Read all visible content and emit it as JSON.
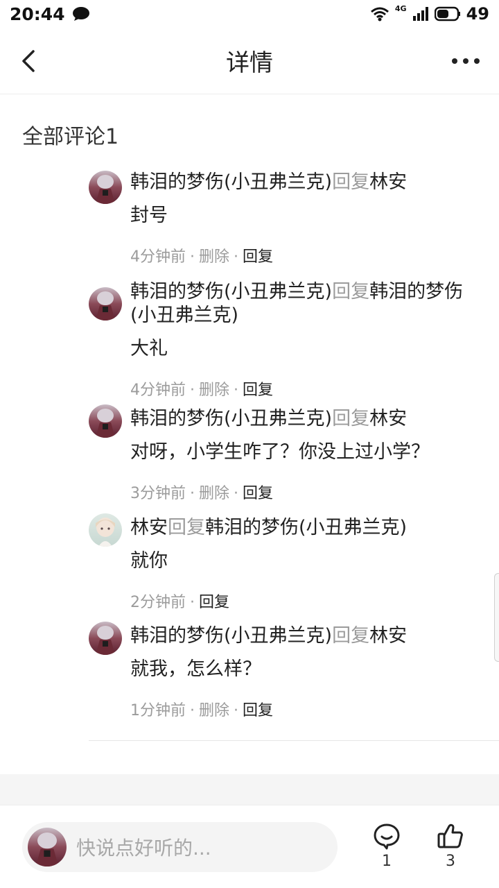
{
  "status_bar": {
    "time": "20:44",
    "network": "4G",
    "battery": "49"
  },
  "header": {
    "title": "详情"
  },
  "section": {
    "title": "全部评论1"
  },
  "comments": [
    {
      "author": "韩泪的梦伤(小丑弗兰克)",
      "reply_word": "回复",
      "target": "林安",
      "text": "封号",
      "time": "4分钟前",
      "delete": "删除",
      "reply": "回复"
    },
    {
      "author": "韩泪的梦伤(小丑弗兰克)",
      "reply_word": "回复",
      "target": "韩泪的梦伤(小丑弗兰克)",
      "text": "大礼",
      "time": "4分钟前",
      "delete": "删除",
      "reply": "回复"
    },
    {
      "author": "韩泪的梦伤(小丑弗兰克)",
      "reply_word": "回复",
      "target": "林安",
      "text": "对呀，小学生咋了？你没上过小学？",
      "time": "3分钟前",
      "delete": "删除",
      "reply": "回复"
    },
    {
      "author": "林安",
      "reply_word": "回复",
      "target": "韩泪的梦伤(小丑弗兰克)",
      "text": "就你",
      "time": "2分钟前",
      "reply": "回复"
    },
    {
      "author": "韩泪的梦伤(小丑弗兰克)",
      "reply_word": "回复",
      "target": "林安",
      "text": "就我，怎么样？",
      "time": "1分钟前",
      "delete": "删除",
      "reply": "回复"
    }
  ],
  "bottom_bar": {
    "placeholder": "快说点好听的...",
    "comment_count": "1",
    "like_count": "3"
  }
}
